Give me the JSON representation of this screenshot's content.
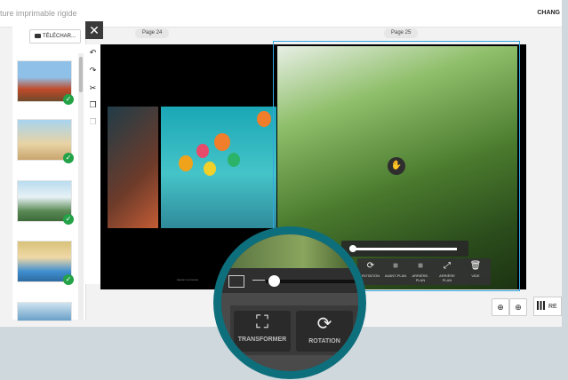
{
  "window": {
    "title": "ture imprimable rigide",
    "top_right_label": "CHANG"
  },
  "sidebar": {
    "download_label": "TÉLÉCHAR...",
    "thumbs": [
      {
        "colors": [
          "#8fc1e8",
          "#c04a2a"
        ]
      },
      {
        "colors": [
          "#a9d4ef",
          "#e8d3a4"
        ]
      },
      {
        "colors": [
          "#b9dcef",
          "#5a8a55"
        ]
      },
      {
        "colors": [
          "#d8c27a",
          "#3f8fd0"
        ]
      },
      {
        "colors": [
          "#cfe3f0",
          "#6aa0c8"
        ]
      }
    ]
  },
  "pages": {
    "left_label": "Page 24",
    "right_label": "Page 25"
  },
  "left_page_footer": "Ajoutez vos textes",
  "tools": {
    "rotation": "ROTATION",
    "front": "AVANT-PLAN",
    "back": "ARRIÈRE-PLAN",
    "background": "ARRIÈRE PLAN",
    "delete": "VIDE"
  },
  "lens": {
    "transform_label": "TRANSFORMER",
    "rotation_label": "ROTATION"
  },
  "zoom_level": 0.05
}
